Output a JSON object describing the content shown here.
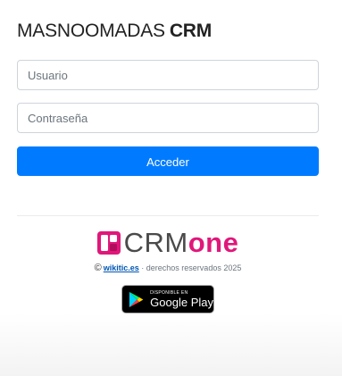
{
  "header": {
    "brand": "MASNOOMADAS",
    "brand_bold": "CRM"
  },
  "login_form": {
    "username_placeholder": "Usuario",
    "username_value": "",
    "password_placeholder": "Contraseña",
    "password_value": "",
    "submit_label": "Acceder"
  },
  "footer": {
    "logo": {
      "text_crm": "CRM",
      "text_one": "one",
      "colors": {
        "crm": "#4a4a4a",
        "one": "#e0177a"
      }
    },
    "copyright": {
      "symbol": "©",
      "link_text": "wikitic.es",
      "rest": " · derechos reservados 2025"
    },
    "store_badge": {
      "small_text": "DISPONIBLE EN",
      "big_text": "Google Play",
      "icon": "google-play-icon"
    }
  },
  "colors": {
    "primary": "#007bff",
    "input_border": "#ced4da",
    "divider": "#e9ecef"
  }
}
